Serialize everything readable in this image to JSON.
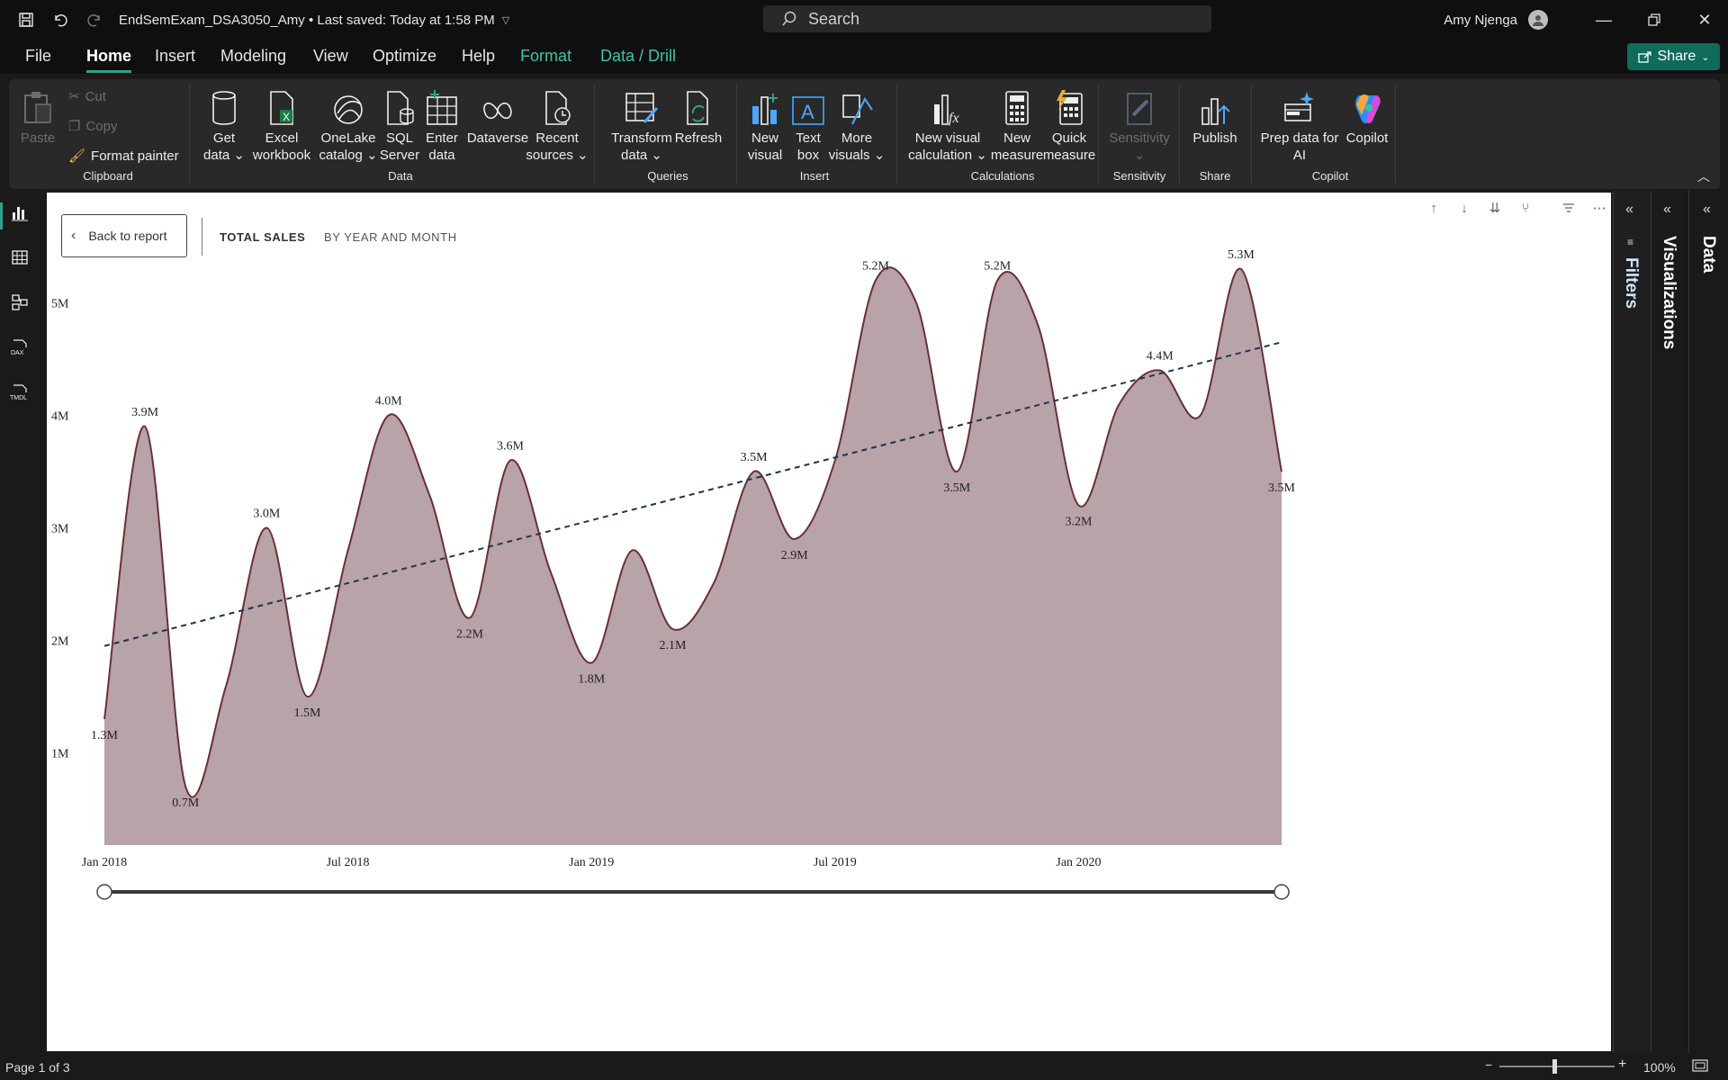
{
  "titlebar": {
    "doc_title": "EndSemExam_DSA3050_Amy • Last saved: Today at 1:58 PM",
    "search_placeholder": "Search",
    "user_name": "Amy Njenga"
  },
  "menu": {
    "file": "File",
    "tabs": [
      "Home",
      "Insert",
      "Modeling",
      "View",
      "Optimize",
      "Help",
      "Format",
      "Data / Drill"
    ],
    "active_tab": "Home",
    "share": "Share"
  },
  "ribbon": {
    "clipboard": {
      "paste": "Paste",
      "cut": "Cut",
      "copy": "Copy",
      "format_painter": "Format painter",
      "label": "Clipboard"
    },
    "data": {
      "get_data": [
        "Get",
        "data"
      ],
      "excel": [
        "Excel",
        "workbook"
      ],
      "onelake": [
        "OneLake",
        "catalog"
      ],
      "sql": [
        "SQL",
        "Server"
      ],
      "enter": [
        "Enter",
        "data"
      ],
      "dataverse": [
        "Dataverse",
        ""
      ],
      "recent": [
        "Recent",
        "sources"
      ],
      "label": "Data"
    },
    "queries": {
      "transform": [
        "Transform",
        "data"
      ],
      "refresh": [
        "Refresh",
        ""
      ],
      "label": "Queries"
    },
    "insert": {
      "new_visual": [
        "New",
        "visual"
      ],
      "text_box": [
        "Text",
        "box"
      ],
      "more_visuals": [
        "More",
        "visuals"
      ],
      "label": "Insert"
    },
    "calculations": {
      "new_visual_calc": [
        "New visual",
        "calculation"
      ],
      "new_measure": [
        "New",
        "measure"
      ],
      "quick_measure": [
        "Quick",
        "measure"
      ],
      "label": "Calculations"
    },
    "sensitivity": {
      "button": "Sensitivity",
      "label": "Sensitivity"
    },
    "share": {
      "publish": "Publish",
      "label": "Share"
    },
    "copilot": {
      "prep": [
        "Prep data for",
        "AI"
      ],
      "copilot": "Copilot",
      "label": "Copilot"
    }
  },
  "canvas": {
    "back_button": "Back to report",
    "crumb_primary": "TOTAL SALES",
    "crumb_secondary": "BY YEAR AND MONTH"
  },
  "panes": {
    "filters": "Filters",
    "visualizations": "Visualizations",
    "data": "Data"
  },
  "status": {
    "page": "Page 1 of 3",
    "zoom": "100%"
  },
  "colors": {
    "area_fill": "#b7a3a8",
    "area_line": "#6b2f36",
    "trend": "#1f3550",
    "accent": "#2ea28c"
  },
  "chart_data": {
    "type": "area",
    "title": "",
    "xlabel": "",
    "ylabel": "",
    "ylim": [
      0.5,
      5.5
    ],
    "y_ticks": [
      "1M",
      "2M",
      "3M",
      "4M",
      "5M"
    ],
    "y_tick_values": [
      1,
      2,
      3,
      4,
      5
    ],
    "x_ticks": [
      "Jan 2018",
      "Jul 2018",
      "Jan 2019",
      "Jul 2019",
      "Jan 2020"
    ],
    "x_tick_index": [
      0,
      6,
      12,
      18,
      24
    ],
    "x": [
      "Jan 2018",
      "Feb 2018",
      "Mar 2018",
      "Apr 2018",
      "May 2018",
      "Jun 2018",
      "Jul 2018",
      "Aug 2018",
      "Sep 2018",
      "Oct 2018",
      "Nov 2018",
      "Dec 2018",
      "Jan 2019",
      "Feb 2019",
      "Mar 2019",
      "Apr 2019",
      "May 2019",
      "Jun 2019",
      "Jul 2019",
      "Aug 2019",
      "Sep 2019",
      "Oct 2019",
      "Nov 2019",
      "Dec 2019",
      "Jan 2020",
      "Feb 2020",
      "Mar 2020",
      "Apr 2020",
      "May 2020",
      "Jun 2020"
    ],
    "series": [
      {
        "name": "Total Sales",
        "values": [
          1.3,
          3.9,
          0.7,
          1.6,
          3.0,
          1.5,
          2.8,
          4.0,
          3.3,
          2.2,
          3.6,
          2.6,
          1.8,
          2.8,
          2.1,
          2.5,
          3.5,
          2.9,
          3.6,
          5.2,
          5.0,
          3.5,
          5.2,
          4.8,
          3.2,
          4.1,
          4.4,
          4.0,
          5.3,
          3.5
        ]
      }
    ],
    "labels": [
      {
        "i": 0,
        "text": "1.3M",
        "pos": "below"
      },
      {
        "i": 1,
        "text": "3.9M",
        "pos": "above"
      },
      {
        "i": 2,
        "text": "0.7M",
        "pos": "below"
      },
      {
        "i": 4,
        "text": "3.0M",
        "pos": "above"
      },
      {
        "i": 5,
        "text": "1.5M",
        "pos": "below"
      },
      {
        "i": 7,
        "text": "4.0M",
        "pos": "above"
      },
      {
        "i": 9,
        "text": "2.2M",
        "pos": "below"
      },
      {
        "i": 10,
        "text": "3.6M",
        "pos": "above"
      },
      {
        "i": 12,
        "text": "1.8M",
        "pos": "below"
      },
      {
        "i": 14,
        "text": "2.1M",
        "pos": "below"
      },
      {
        "i": 16,
        "text": "3.5M",
        "pos": "above"
      },
      {
        "i": 17,
        "text": "2.9M",
        "pos": "below"
      },
      {
        "i": 19,
        "text": "5.2M",
        "pos": "above"
      },
      {
        "i": 21,
        "text": "3.5M",
        "pos": "below"
      },
      {
        "i": 22,
        "text": "5.2M",
        "pos": "above"
      },
      {
        "i": 24,
        "text": "3.2M",
        "pos": "below"
      },
      {
        "i": 26,
        "text": "4.4M",
        "pos": "above"
      },
      {
        "i": 28,
        "text": "5.3M",
        "pos": "above"
      },
      {
        "i": 29,
        "text": "3.5M",
        "pos": "below"
      }
    ],
    "trendline": {
      "start": 1.95,
      "end": 4.65,
      "style": "dashed"
    },
    "grid": false,
    "range_slider": true
  }
}
